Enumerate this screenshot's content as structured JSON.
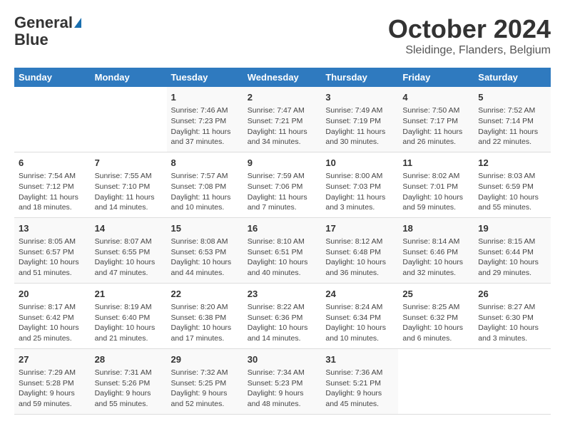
{
  "header": {
    "logo_line1": "General",
    "logo_line2": "Blue",
    "month": "October 2024",
    "location": "Sleidinge, Flanders, Belgium"
  },
  "weekdays": [
    "Sunday",
    "Monday",
    "Tuesday",
    "Wednesday",
    "Thursday",
    "Friday",
    "Saturday"
  ],
  "weeks": [
    [
      {
        "day": "",
        "info": ""
      },
      {
        "day": "",
        "info": ""
      },
      {
        "day": "1",
        "info": "Sunrise: 7:46 AM\nSunset: 7:23 PM\nDaylight: 11 hours\nand 37 minutes."
      },
      {
        "day": "2",
        "info": "Sunrise: 7:47 AM\nSunset: 7:21 PM\nDaylight: 11 hours\nand 34 minutes."
      },
      {
        "day": "3",
        "info": "Sunrise: 7:49 AM\nSunset: 7:19 PM\nDaylight: 11 hours\nand 30 minutes."
      },
      {
        "day": "4",
        "info": "Sunrise: 7:50 AM\nSunset: 7:17 PM\nDaylight: 11 hours\nand 26 minutes."
      },
      {
        "day": "5",
        "info": "Sunrise: 7:52 AM\nSunset: 7:14 PM\nDaylight: 11 hours\nand 22 minutes."
      }
    ],
    [
      {
        "day": "6",
        "info": "Sunrise: 7:54 AM\nSunset: 7:12 PM\nDaylight: 11 hours\nand 18 minutes."
      },
      {
        "day": "7",
        "info": "Sunrise: 7:55 AM\nSunset: 7:10 PM\nDaylight: 11 hours\nand 14 minutes."
      },
      {
        "day": "8",
        "info": "Sunrise: 7:57 AM\nSunset: 7:08 PM\nDaylight: 11 hours\nand 10 minutes."
      },
      {
        "day": "9",
        "info": "Sunrise: 7:59 AM\nSunset: 7:06 PM\nDaylight: 11 hours\nand 7 minutes."
      },
      {
        "day": "10",
        "info": "Sunrise: 8:00 AM\nSunset: 7:03 PM\nDaylight: 11 hours\nand 3 minutes."
      },
      {
        "day": "11",
        "info": "Sunrise: 8:02 AM\nSunset: 7:01 PM\nDaylight: 10 hours\nand 59 minutes."
      },
      {
        "day": "12",
        "info": "Sunrise: 8:03 AM\nSunset: 6:59 PM\nDaylight: 10 hours\nand 55 minutes."
      }
    ],
    [
      {
        "day": "13",
        "info": "Sunrise: 8:05 AM\nSunset: 6:57 PM\nDaylight: 10 hours\nand 51 minutes."
      },
      {
        "day": "14",
        "info": "Sunrise: 8:07 AM\nSunset: 6:55 PM\nDaylight: 10 hours\nand 47 minutes."
      },
      {
        "day": "15",
        "info": "Sunrise: 8:08 AM\nSunset: 6:53 PM\nDaylight: 10 hours\nand 44 minutes."
      },
      {
        "day": "16",
        "info": "Sunrise: 8:10 AM\nSunset: 6:51 PM\nDaylight: 10 hours\nand 40 minutes."
      },
      {
        "day": "17",
        "info": "Sunrise: 8:12 AM\nSunset: 6:48 PM\nDaylight: 10 hours\nand 36 minutes."
      },
      {
        "day": "18",
        "info": "Sunrise: 8:14 AM\nSunset: 6:46 PM\nDaylight: 10 hours\nand 32 minutes."
      },
      {
        "day": "19",
        "info": "Sunrise: 8:15 AM\nSunset: 6:44 PM\nDaylight: 10 hours\nand 29 minutes."
      }
    ],
    [
      {
        "day": "20",
        "info": "Sunrise: 8:17 AM\nSunset: 6:42 PM\nDaylight: 10 hours\nand 25 minutes."
      },
      {
        "day": "21",
        "info": "Sunrise: 8:19 AM\nSunset: 6:40 PM\nDaylight: 10 hours\nand 21 minutes."
      },
      {
        "day": "22",
        "info": "Sunrise: 8:20 AM\nSunset: 6:38 PM\nDaylight: 10 hours\nand 17 minutes."
      },
      {
        "day": "23",
        "info": "Sunrise: 8:22 AM\nSunset: 6:36 PM\nDaylight: 10 hours\nand 14 minutes."
      },
      {
        "day": "24",
        "info": "Sunrise: 8:24 AM\nSunset: 6:34 PM\nDaylight: 10 hours\nand 10 minutes."
      },
      {
        "day": "25",
        "info": "Sunrise: 8:25 AM\nSunset: 6:32 PM\nDaylight: 10 hours\nand 6 minutes."
      },
      {
        "day": "26",
        "info": "Sunrise: 8:27 AM\nSunset: 6:30 PM\nDaylight: 10 hours\nand 3 minutes."
      }
    ],
    [
      {
        "day": "27",
        "info": "Sunrise: 7:29 AM\nSunset: 5:28 PM\nDaylight: 9 hours\nand 59 minutes."
      },
      {
        "day": "28",
        "info": "Sunrise: 7:31 AM\nSunset: 5:26 PM\nDaylight: 9 hours\nand 55 minutes."
      },
      {
        "day": "29",
        "info": "Sunrise: 7:32 AM\nSunset: 5:25 PM\nDaylight: 9 hours\nand 52 minutes."
      },
      {
        "day": "30",
        "info": "Sunrise: 7:34 AM\nSunset: 5:23 PM\nDaylight: 9 hours\nand 48 minutes."
      },
      {
        "day": "31",
        "info": "Sunrise: 7:36 AM\nSunset: 5:21 PM\nDaylight: 9 hours\nand 45 minutes."
      },
      {
        "day": "",
        "info": ""
      },
      {
        "day": "",
        "info": ""
      }
    ]
  ]
}
